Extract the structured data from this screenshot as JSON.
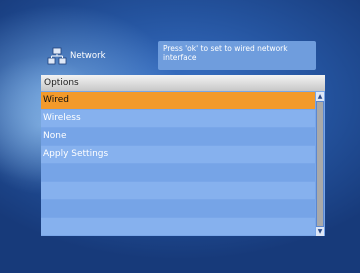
{
  "header": {
    "title": "Network",
    "icon": "network-icon"
  },
  "hint": {
    "text": "Press 'ok' to set to wired network interface"
  },
  "options": {
    "title": "Options",
    "items": [
      {
        "label": "Wired",
        "selected": true
      },
      {
        "label": "Wireless",
        "selected": false
      },
      {
        "label": "None",
        "selected": false
      },
      {
        "label": "Apply Settings",
        "selected": false
      }
    ],
    "selected_color": "#f39a2b"
  },
  "scrollbar": {
    "up_glyph": "▲",
    "down_glyph": "▼"
  }
}
